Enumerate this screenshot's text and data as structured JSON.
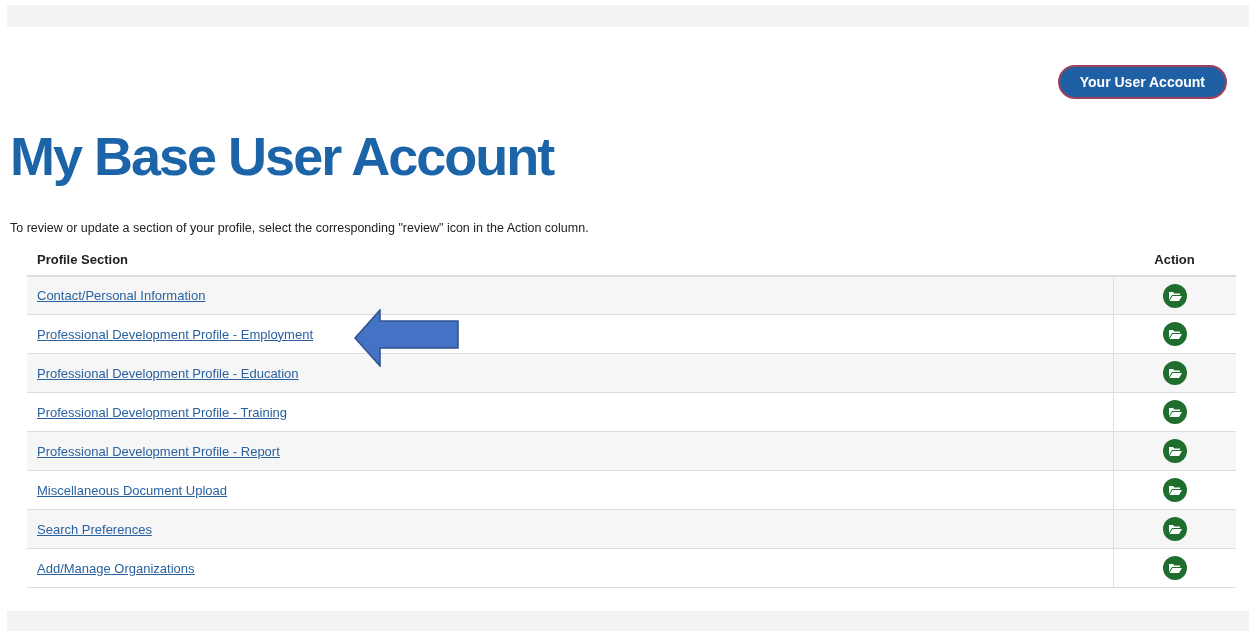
{
  "account_button": "Your User Account",
  "title": "My Base User Account",
  "instructions": "To review or update a section of your profile, select the corresponding \"review\" icon in the Action column.",
  "table": {
    "columns": [
      "Profile Section",
      "Action"
    ],
    "rows": [
      {
        "section": "Contact/Personal Information"
      },
      {
        "section": "Professional Development Profile - Employment"
      },
      {
        "section": "Professional Development Profile - Education"
      },
      {
        "section": "Professional Development Profile - Training"
      },
      {
        "section": "Professional Development Profile - Report"
      },
      {
        "section": "Miscellaneous Document Upload"
      },
      {
        "section": "Search Preferences"
      },
      {
        "section": "Add/Manage Organizations"
      }
    ]
  }
}
